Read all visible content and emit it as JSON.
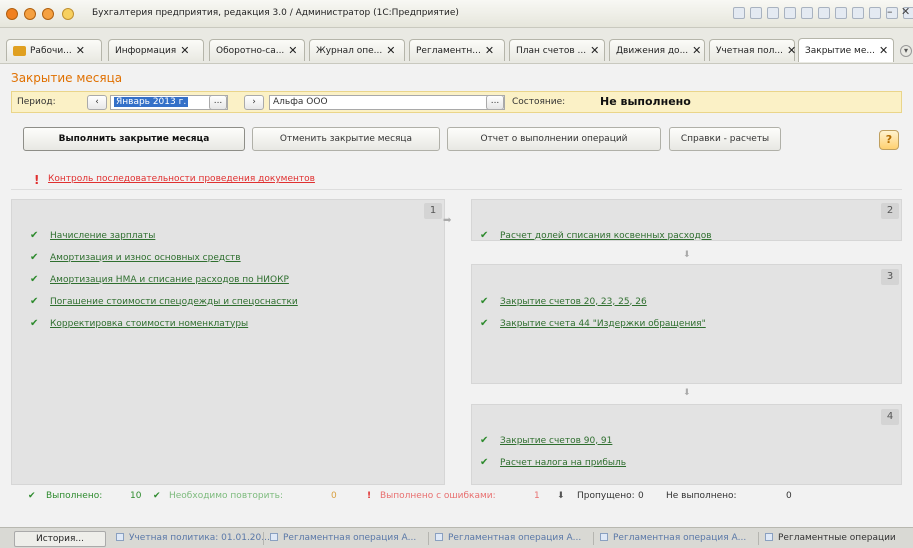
{
  "window": {
    "title": "Бухгалтерия предприятия, редакция 3.0 / Администратор  (1С:Предприятие)"
  },
  "tabs": [
    {
      "label": "Рабочи..."
    },
    {
      "label": "Информация"
    },
    {
      "label": "Оборотно-са..."
    },
    {
      "label": "Журнал опе..."
    },
    {
      "label": "Регламентн..."
    },
    {
      "label": "План счетов ..."
    },
    {
      "label": "Движения до..."
    },
    {
      "label": "Учетная пол..."
    },
    {
      "label": "Закрытие ме..."
    }
  ],
  "form": {
    "title": "Закрытие месяца",
    "period_label": "Период:",
    "period_value": "Январь 2013 г.",
    "org_value": "Альфа ООО",
    "state_label": "Состояние:",
    "state_value": "Не выполнено"
  },
  "actions": {
    "run": "Выполнить закрытие месяца",
    "cancel": "Отменить закрытие месяца",
    "report": "Отчет о выполнении операций",
    "refs": "Справки - расчеты",
    "help": "?"
  },
  "control_link": "Контроль последовательности проведения документов",
  "panels": [
    {
      "num": "1",
      "items": [
        "Начисление зарплаты",
        "Амортизация и износ основных средств",
        "Амортизация НМА и списание расходов по НИОКР",
        "Погашение стоимости спецодежды и спецоснастки",
        "Корректировка стоимости номенклатуры"
      ]
    },
    {
      "num": "2",
      "items": [
        "Расчет долей списания косвенных расходов"
      ]
    },
    {
      "num": "3",
      "items": [
        "Закрытие счетов 20, 23, 25, 26",
        "Закрытие счета 44 \"Издержки обращения\""
      ]
    },
    {
      "num": "4",
      "items": [
        "Закрытие счетов 90, 91",
        "Расчет налога на прибыль"
      ]
    }
  ],
  "summary": {
    "done_label": "Выполнено:",
    "done_count": "10",
    "repeat_label": "Необходимо повторить:",
    "repeat_count": "0",
    "errors_label": "Выполнено с ошибками:",
    "errors_count": "1",
    "skipped_label": "Пропущено:",
    "skipped_count": "0",
    "notdone_label": "Не выполнено:",
    "notdone_count": "0"
  },
  "statusbar": {
    "history": "История...",
    "items": [
      "Учетная политика: 01.01.20...",
      "Регламентная операция А...",
      "Регламентная операция А...",
      "Регламентная операция А...",
      "Регламентные операции"
    ]
  },
  "colors": {
    "accent_orange": "#e07000",
    "ok_green": "#2e8b2e",
    "error_red": "#e03030",
    "period_bar": "#fbf1c6"
  }
}
